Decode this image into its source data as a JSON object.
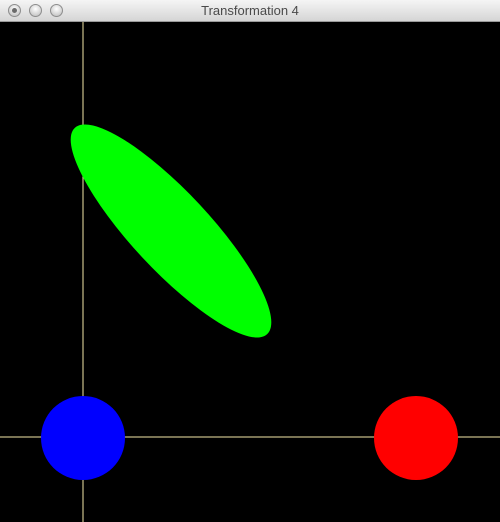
{
  "window": {
    "title": "Transformation 4"
  },
  "scene": {
    "background_color": "#000000",
    "axes_color": "#f3e8a8",
    "shapes": [
      {
        "name": "green-ellipse",
        "color": "#00ff00"
      },
      {
        "name": "blue-circle",
        "color": "#0000ff"
      },
      {
        "name": "red-circle",
        "color": "#ff0000"
      }
    ]
  }
}
